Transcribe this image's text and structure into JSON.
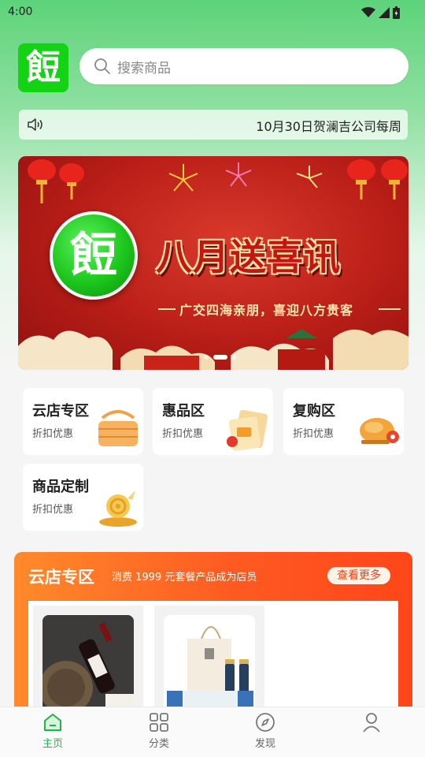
{
  "status_bar": {
    "time": "4:00"
  },
  "app": {
    "logo_text": "餖"
  },
  "search": {
    "placeholder": "搜索商品"
  },
  "notice": {
    "text": "10月30日贺澜吉公司每周"
  },
  "banner": {
    "title": "八月送喜讯",
    "subtitle": "广交四海亲朋，喜迎八方贵客",
    "slides": 3,
    "active_slide": 2
  },
  "categories": [
    {
      "title": "云店专区",
      "subtitle": "折扣优惠",
      "icon": "basket-icon"
    },
    {
      "title": "惠品区",
      "subtitle": "折扣优惠",
      "icon": "coupon-icon"
    },
    {
      "title": "复购区",
      "subtitle": "折扣优惠",
      "icon": "roast-chicken-icon"
    },
    {
      "title": "商品定制",
      "subtitle": "折扣优惠",
      "icon": "gold-snail-icon"
    }
  ],
  "section": {
    "title": "云店专区",
    "subtitle": "消费 1999 元套餐产品成为店员",
    "more_label": "查看更多",
    "products": [
      {
        "icon": "wine-bottle-image"
      },
      {
        "icon": "gift-bag-image"
      }
    ]
  },
  "tabbar": [
    {
      "label": "主页",
      "icon": "home-icon",
      "active": true
    },
    {
      "label": "分类",
      "icon": "grid-icon",
      "active": false
    },
    {
      "label": "发现",
      "icon": "compass-icon",
      "active": false
    },
    {
      "label": "",
      "icon": "profile-icon",
      "active": false
    }
  ],
  "colors": {
    "brand_green": "#14d314",
    "tab_active": "#22b14c",
    "section_orange": "#ff5a22",
    "banner_red": "#b81d17"
  }
}
